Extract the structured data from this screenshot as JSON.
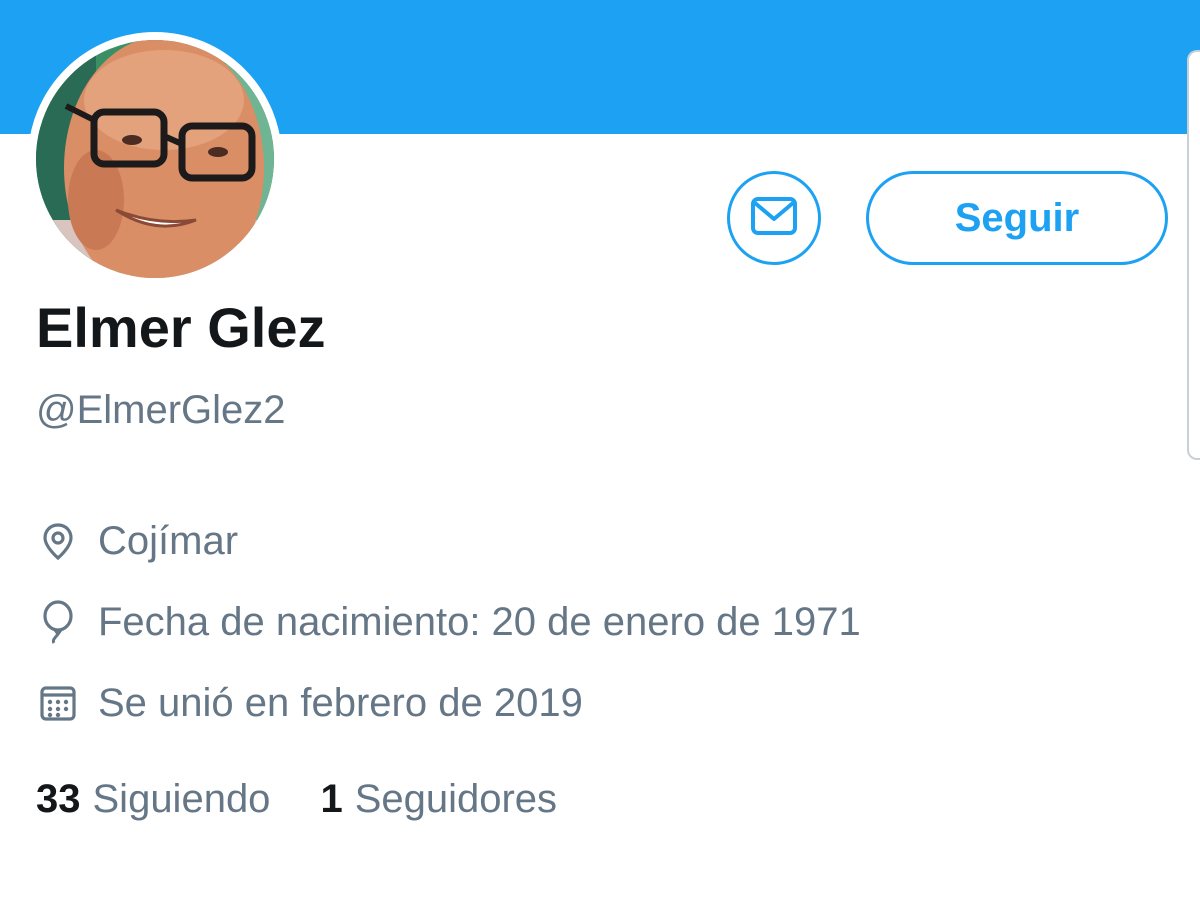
{
  "profile": {
    "display_name": "Elmer Glez",
    "handle": "@ElmerGlez2",
    "avatar_icon": "profile-photo"
  },
  "actions": {
    "message_icon": "envelope-icon",
    "follow_label": "Seguir"
  },
  "details": {
    "location": "Cojímar",
    "birth_date": "Fecha de nacimiento: 20 de enero de 1971",
    "joined": "Se unió en febrero de 2019"
  },
  "stats": {
    "following_count": "33",
    "following_label": "Siguiendo",
    "followers_count": "1",
    "followers_label": "Seguidores"
  },
  "colors": {
    "accent": "#1da1f2",
    "primary_text": "#14171a",
    "secondary_text": "#657786"
  }
}
